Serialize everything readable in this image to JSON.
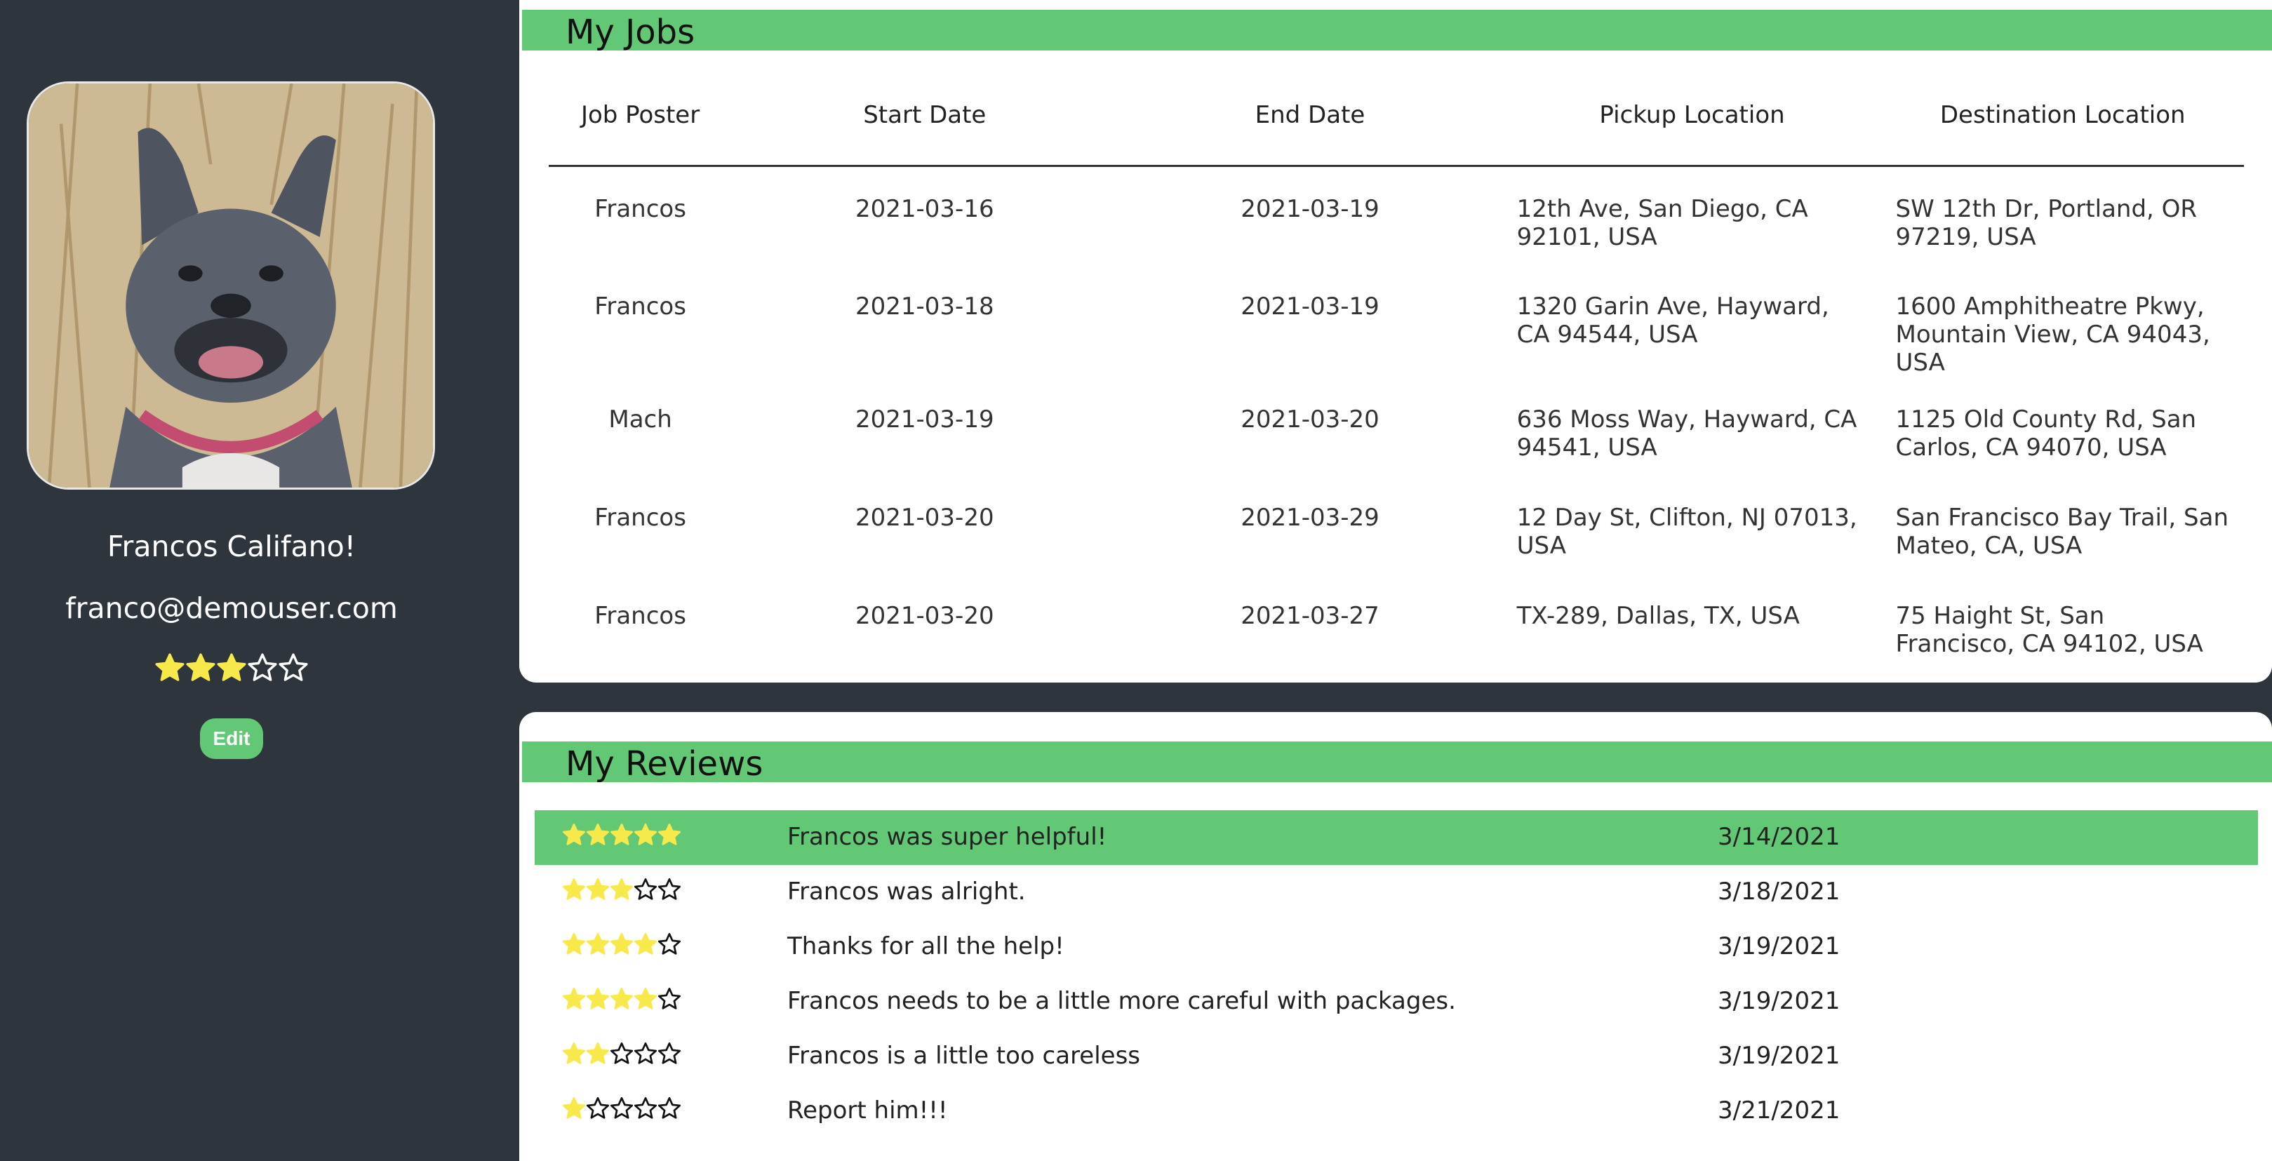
{
  "colors": {
    "sidebar_bg": "#2f353d",
    "accent_green": "#63c876",
    "star_yellow": "#f8e94a"
  },
  "profile": {
    "avatar_icon": "french-bulldog-photo",
    "name": "Francos Califano!",
    "email": "franco@demouser.com",
    "rating": 3,
    "rating_max": 5,
    "edit_label": "Edit"
  },
  "jobs": {
    "title": "My Jobs",
    "columns": [
      "Job Poster",
      "Start Date",
      "End Date",
      "Pickup Location",
      "Destination Location"
    ],
    "rows": [
      {
        "poster": "Francos",
        "start": "2021-03-16",
        "end": "2021-03-19",
        "pickup": "12th Ave, San Diego, CA 92101, USA",
        "destination": "SW 12th Dr, Portland, OR 97219, USA"
      },
      {
        "poster": "Francos",
        "start": "2021-03-18",
        "end": "2021-03-19",
        "pickup": "1320 Garin Ave, Hayward, CA 94544, USA",
        "destination": "1600 Amphitheatre Pkwy, Mountain View, CA 94043, USA"
      },
      {
        "poster": "Mach",
        "start": "2021-03-19",
        "end": "2021-03-20",
        "pickup": "636 Moss Way, Hayward, CA 94541, USA",
        "destination": "1125 Old County Rd, San Carlos, CA 94070, USA"
      },
      {
        "poster": "Francos",
        "start": "2021-03-20",
        "end": "2021-03-29",
        "pickup": "12 Day St, Clifton, NJ 07013, USA",
        "destination": "San Francisco Bay Trail, San Mateo, CA, USA"
      },
      {
        "poster": "Francos",
        "start": "2021-03-20",
        "end": "2021-03-27",
        "pickup": "TX-289, Dallas, TX, USA",
        "destination": "75 Haight St, San Francisco, CA 94102, USA"
      }
    ]
  },
  "reviews": {
    "title": "My Reviews",
    "items": [
      {
        "rating": 5,
        "text": "Francos was super helpful!",
        "date": "3/14/2021",
        "highlighted": true
      },
      {
        "rating": 3,
        "text": "Francos was alright.",
        "date": "3/18/2021",
        "highlighted": false
      },
      {
        "rating": 4,
        "text": "Thanks for all the help!",
        "date": "3/19/2021",
        "highlighted": false
      },
      {
        "rating": 4,
        "text": "Francos needs to be a little more careful with packages.",
        "date": "3/19/2021",
        "highlighted": false
      },
      {
        "rating": 2,
        "text": "Francos is a little too careless",
        "date": "3/19/2021",
        "highlighted": false
      },
      {
        "rating": 1,
        "text": "Report him!!!",
        "date": "3/21/2021",
        "highlighted": false
      }
    ]
  }
}
